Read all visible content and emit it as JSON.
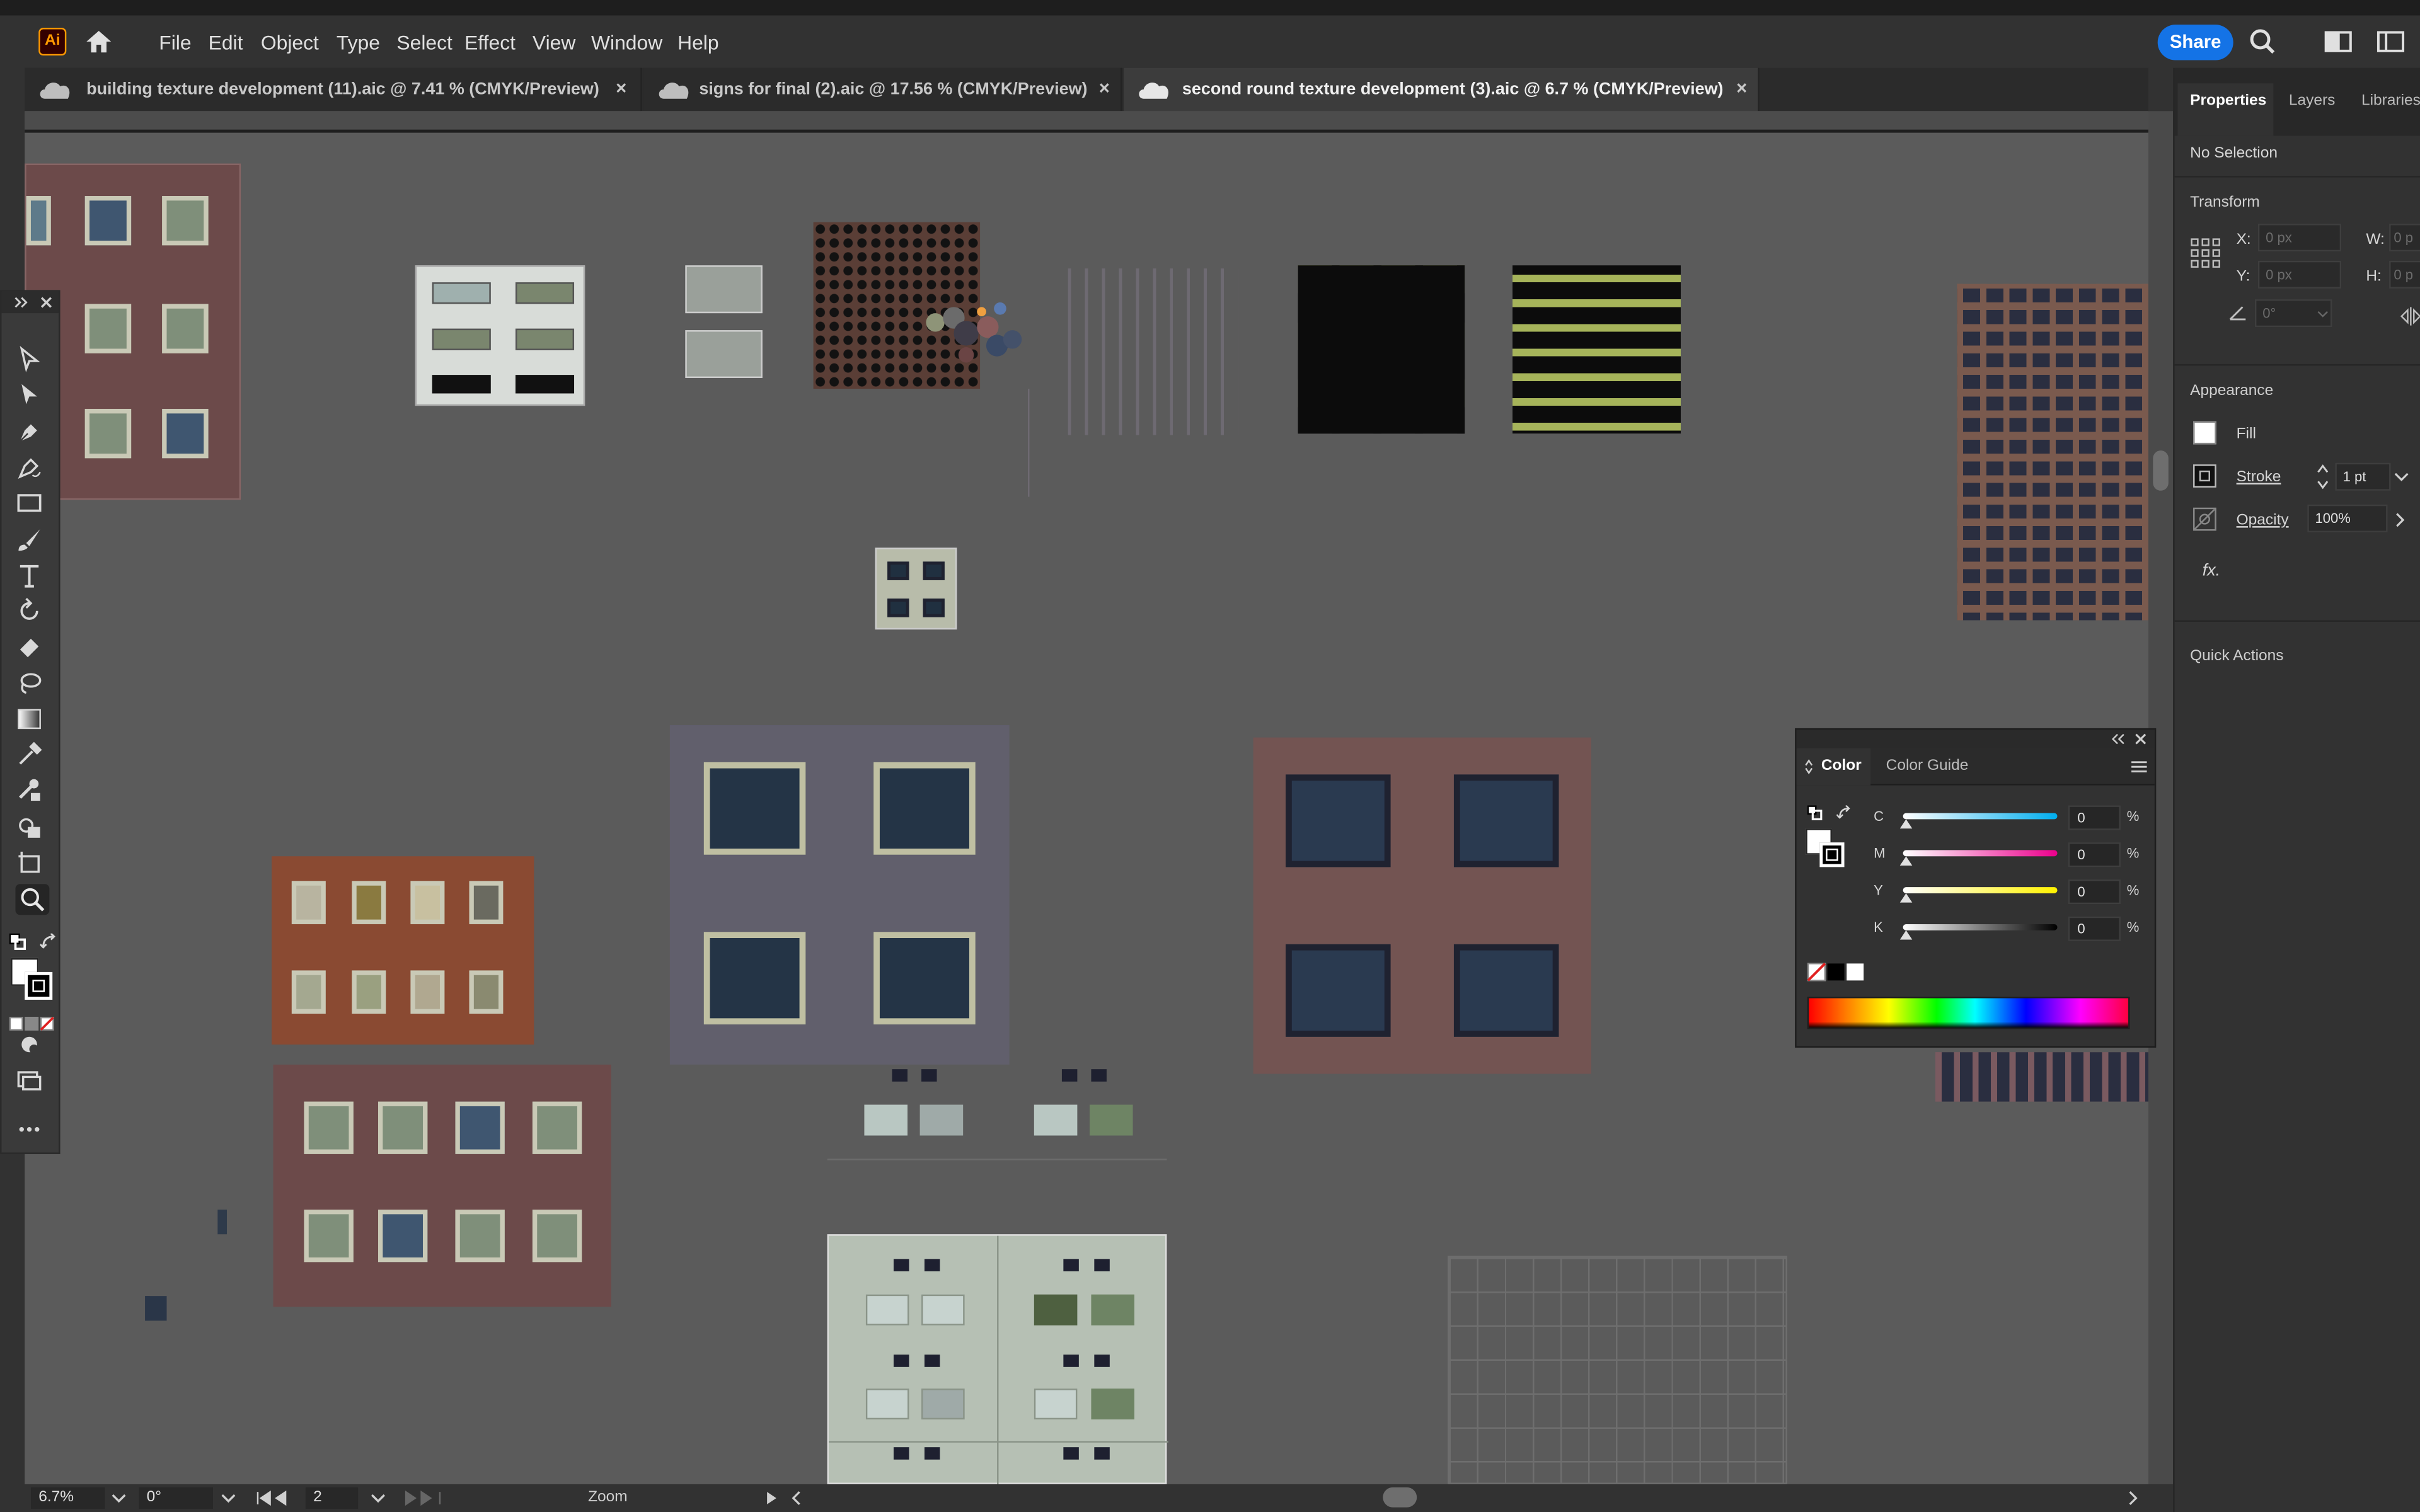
{
  "menubar": {
    "app_logo": "Ai",
    "items": [
      "File",
      "Edit",
      "Object",
      "Type",
      "Select",
      "Effect",
      "View",
      "Window",
      "Help"
    ],
    "share_label": "Share"
  },
  "tabs": [
    {
      "label": "building texture development (11).aic @ 7.41 % (CMYK/Preview)",
      "active": false
    },
    {
      "label": "signs for final (2).aic @ 17.56 % (CMYK/Preview)",
      "active": false
    },
    {
      "label": "second round texture development (3).aic @ 6.7 % (CMYK/Preview)",
      "active": true
    }
  ],
  "tab_close_glyph": "×",
  "statusbar": {
    "zoom": "6.7%",
    "rotation": "0°",
    "artboard": "2",
    "tool_name": "Zoom"
  },
  "right_panel": {
    "tabs": [
      "Properties",
      "Layers",
      "Libraries"
    ],
    "selection": "No Selection",
    "transform": {
      "heading": "Transform",
      "x_label": "X:",
      "x_placeholder": "0 px",
      "y_label": "Y:",
      "y_placeholder": "0 px",
      "w_label": "W:",
      "w_placeholder": "0 p",
      "h_label": "H:",
      "h_placeholder": "0 p",
      "angle_placeholder": "0°"
    },
    "appearance": {
      "heading": "Appearance",
      "fill_label": "Fill",
      "stroke_label": "Stroke",
      "stroke_value": "1 pt",
      "opacity_label": "Opacity",
      "opacity_value": "100%",
      "fx_label": "fx."
    },
    "quick_actions": "Quick Actions"
  },
  "color_panel": {
    "tabs": [
      "Color",
      "Color Guide"
    ],
    "channels": [
      {
        "letter": "C",
        "value": "0",
        "unit": "%",
        "gradient": "linear-gradient(to right,#ffffff,#00aeef)"
      },
      {
        "letter": "M",
        "value": "0",
        "unit": "%",
        "gradient": "linear-gradient(to right,#ffffff,#ec008c)"
      },
      {
        "letter": "Y",
        "value": "0",
        "unit": "%",
        "gradient": "linear-gradient(to right,#ffffff,#fff200)"
      },
      {
        "letter": "K",
        "value": "0",
        "unit": "%",
        "gradient": "linear-gradient(to right,#ffffff,#000000)"
      }
    ]
  },
  "colors": {
    "accent": "#1473e6",
    "canvas": "#5b5b5b",
    "chrome": "#323232"
  },
  "icons": [
    "home-icon",
    "search-icon",
    "workspace-icon",
    "panel-toggle-icon",
    "cloud-icon",
    "close-icon"
  ]
}
